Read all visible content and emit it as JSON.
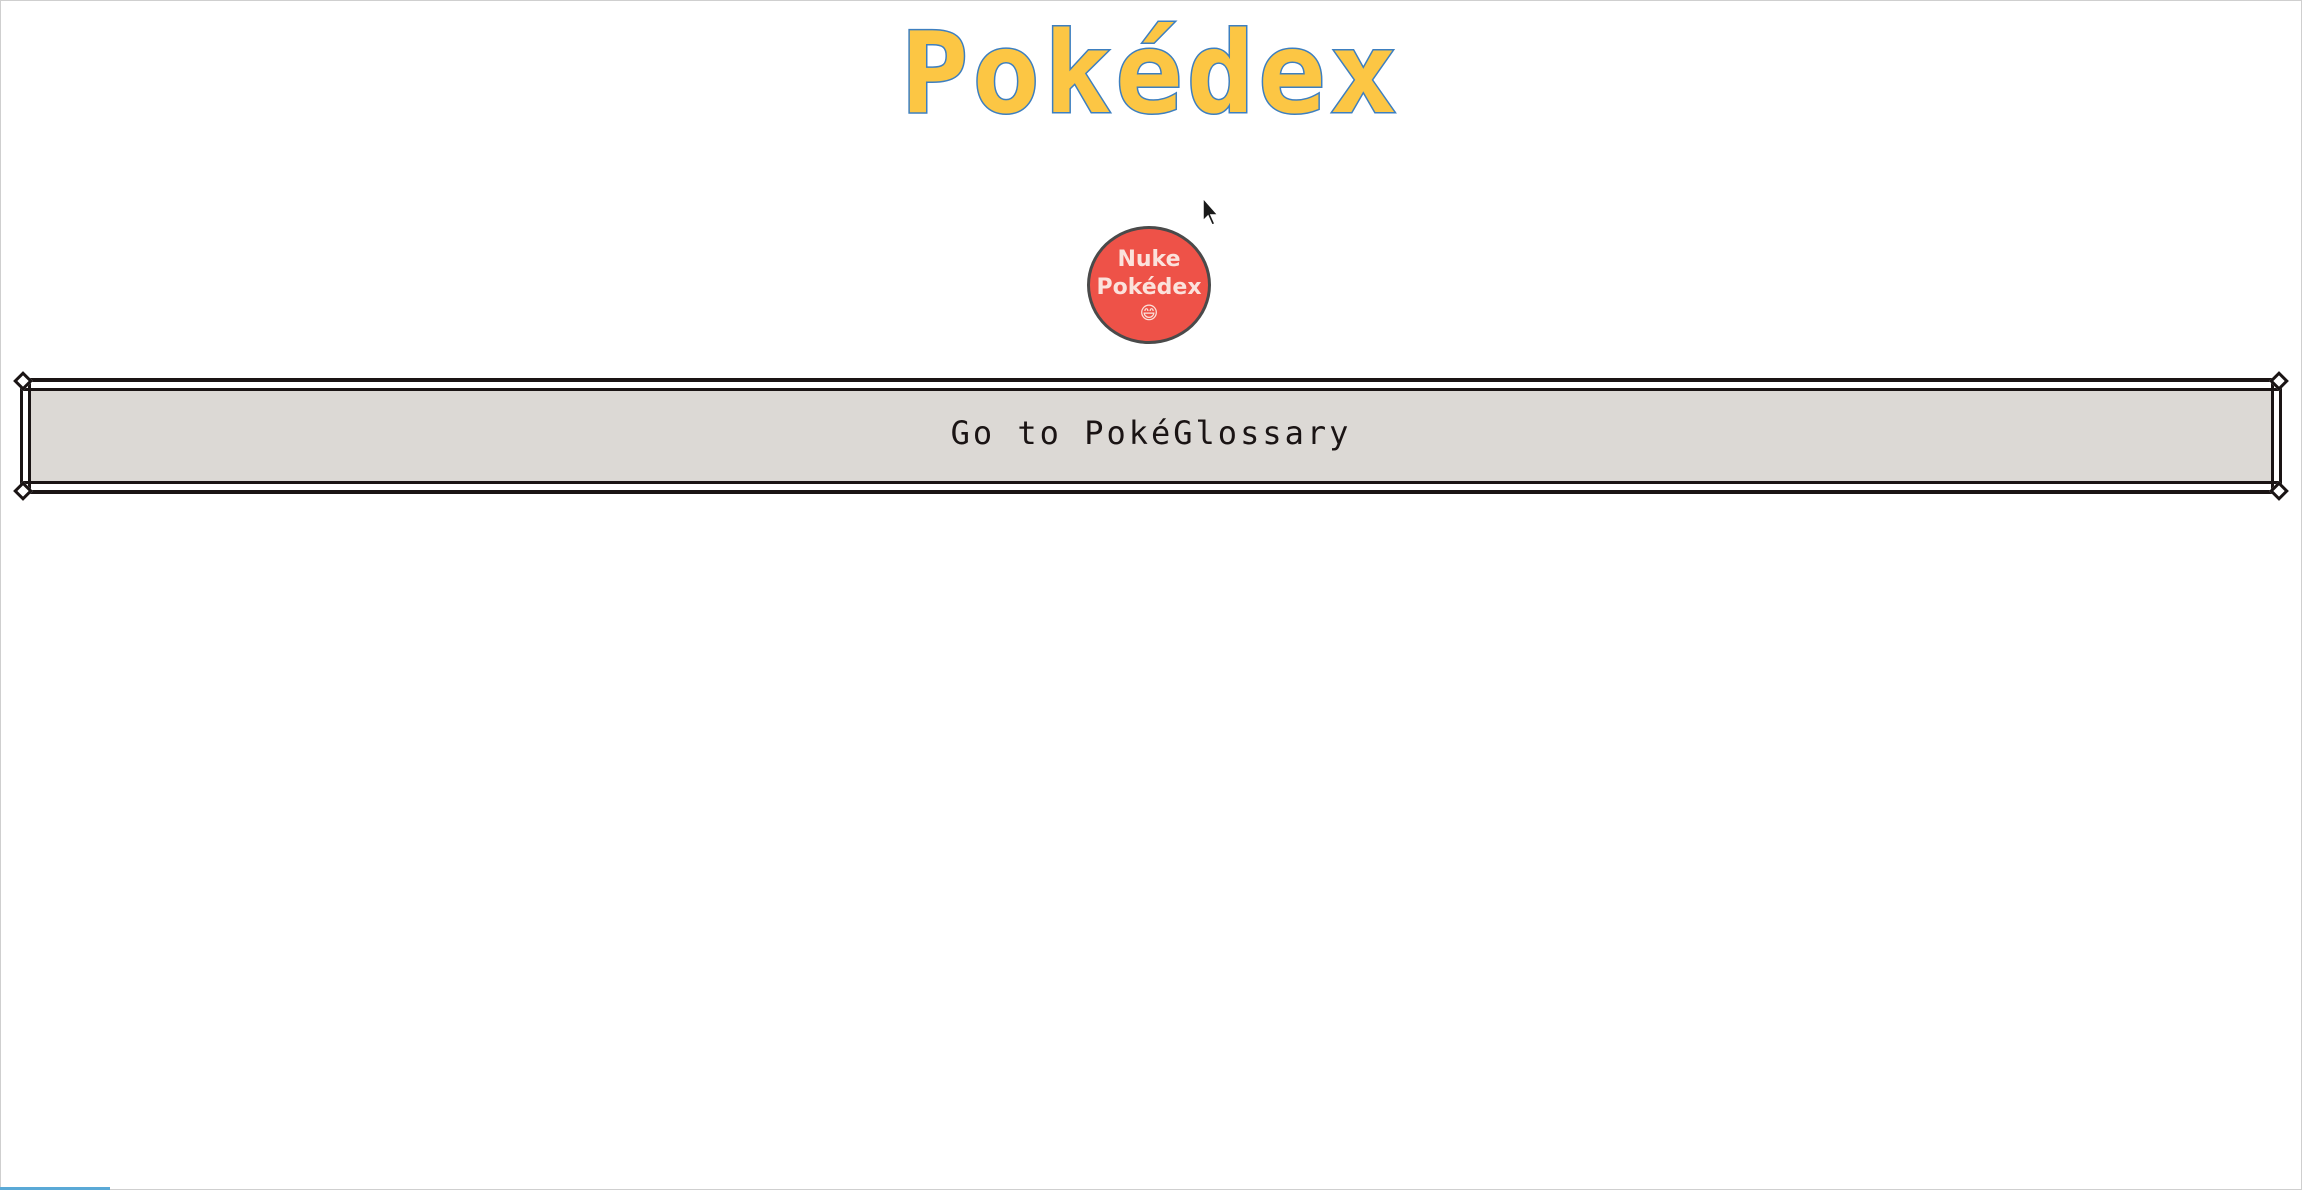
{
  "header": {
    "title": "Pokédex",
    "title_fill_color": "#fcc644",
    "title_outline_color": "#3d7fc0"
  },
  "nuke_button": {
    "line1": "Nuke",
    "line2": "Pokédex",
    "emoji": "😄",
    "color": "#ee5248"
  },
  "glossary_button": {
    "label": "Go to PokéGlossary",
    "background": "#dcd9d5"
  }
}
